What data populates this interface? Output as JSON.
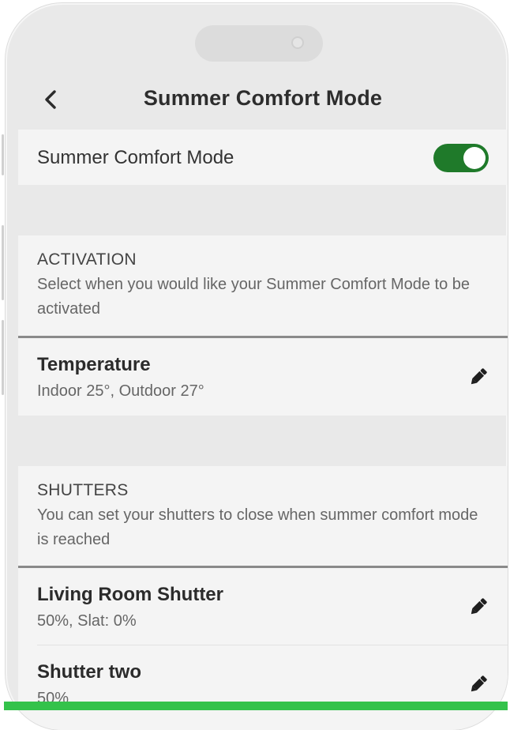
{
  "header": {
    "title": "Summer Comfort Mode"
  },
  "toggle_row": {
    "label": "Summer Comfort Mode",
    "enabled": true,
    "color": "#1f7a2a"
  },
  "activation": {
    "title": "ACTIVATION",
    "description": "Select when you would like your Summer Comfort Mode to be activated",
    "items": [
      {
        "title": "Temperature",
        "subtitle": "Indoor 25°, Outdoor 27°"
      }
    ]
  },
  "shutters": {
    "title": "SHUTTERS",
    "description": "You can set your shutters to close when summer comfort mode is reached",
    "items": [
      {
        "title": "Living Room Shutter",
        "subtitle": "50%, Slat: 0%"
      },
      {
        "title": "Shutter two",
        "subtitle": "50%"
      }
    ]
  },
  "icons": {
    "back": "chevron-left-icon",
    "edit": "pencil-icon"
  },
  "colors": {
    "accent_bar": "#34c24b"
  }
}
